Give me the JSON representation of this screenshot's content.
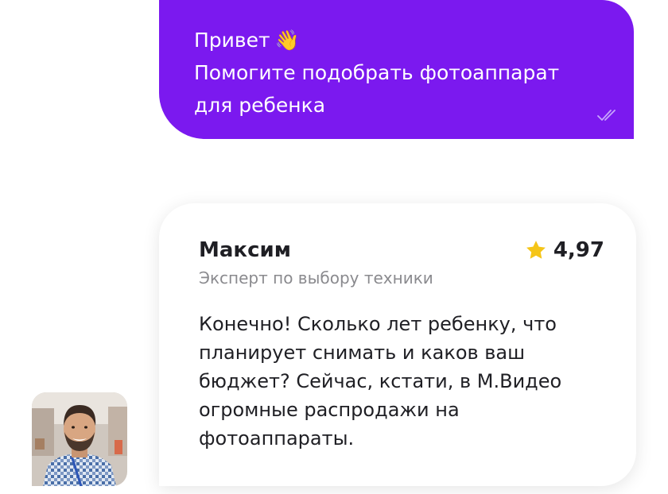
{
  "user_message": {
    "lines": [
      "Привет",
      "Помогите подобрать фотоаппарат",
      "для ребенка"
    ],
    "emoji": "👋",
    "status_icon": "double-check-icon"
  },
  "expert_message": {
    "name": "Максим",
    "role": "Эксперт по выбору техники",
    "rating": "4,97",
    "rating_icon": "star-icon",
    "text": "Конечно! Сколько лет ребенку, что планирует снимать и каков ваш бюджет? Сейчас, кстати, в М.Видео огромные распродажи на фотоаппараты."
  },
  "colors": {
    "user_bubble": "#7b19ef",
    "star": "#f5c518",
    "text_dark": "#1f1f24",
    "text_muted": "#8a8a8e"
  }
}
